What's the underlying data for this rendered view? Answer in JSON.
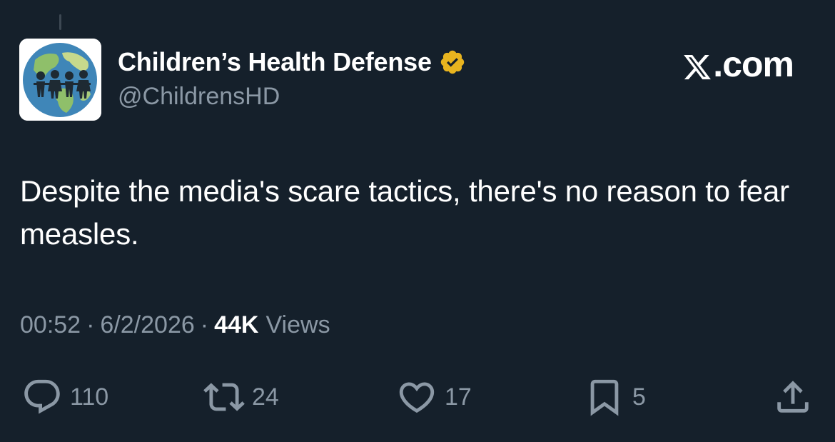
{
  "author": {
    "display_name": "Children’s Health Defense",
    "handle": "@ChildrensHD",
    "verified": true,
    "verified_color": "#e8b41f"
  },
  "brand": {
    "label": ".com"
  },
  "post": {
    "text": "Despite the media's scare tactics, there's no reason to fear measles.",
    "time": "00:52",
    "date": "6/2/2026",
    "views_count": "44K",
    "views_label": "Views"
  },
  "actions": {
    "replies": "110",
    "reposts": "24",
    "likes": "17",
    "bookmarks": "5"
  },
  "icons": {
    "reply": "reply-icon",
    "repost": "repost-icon",
    "like": "heart-icon",
    "bookmark": "bookmark-icon",
    "share": "share-icon",
    "verified": "verified-badge-icon",
    "brand": "x-logo-icon"
  },
  "colors": {
    "background": "#15202b",
    "primary_text": "#ffffff",
    "secondary_text": "#8b98a5"
  }
}
